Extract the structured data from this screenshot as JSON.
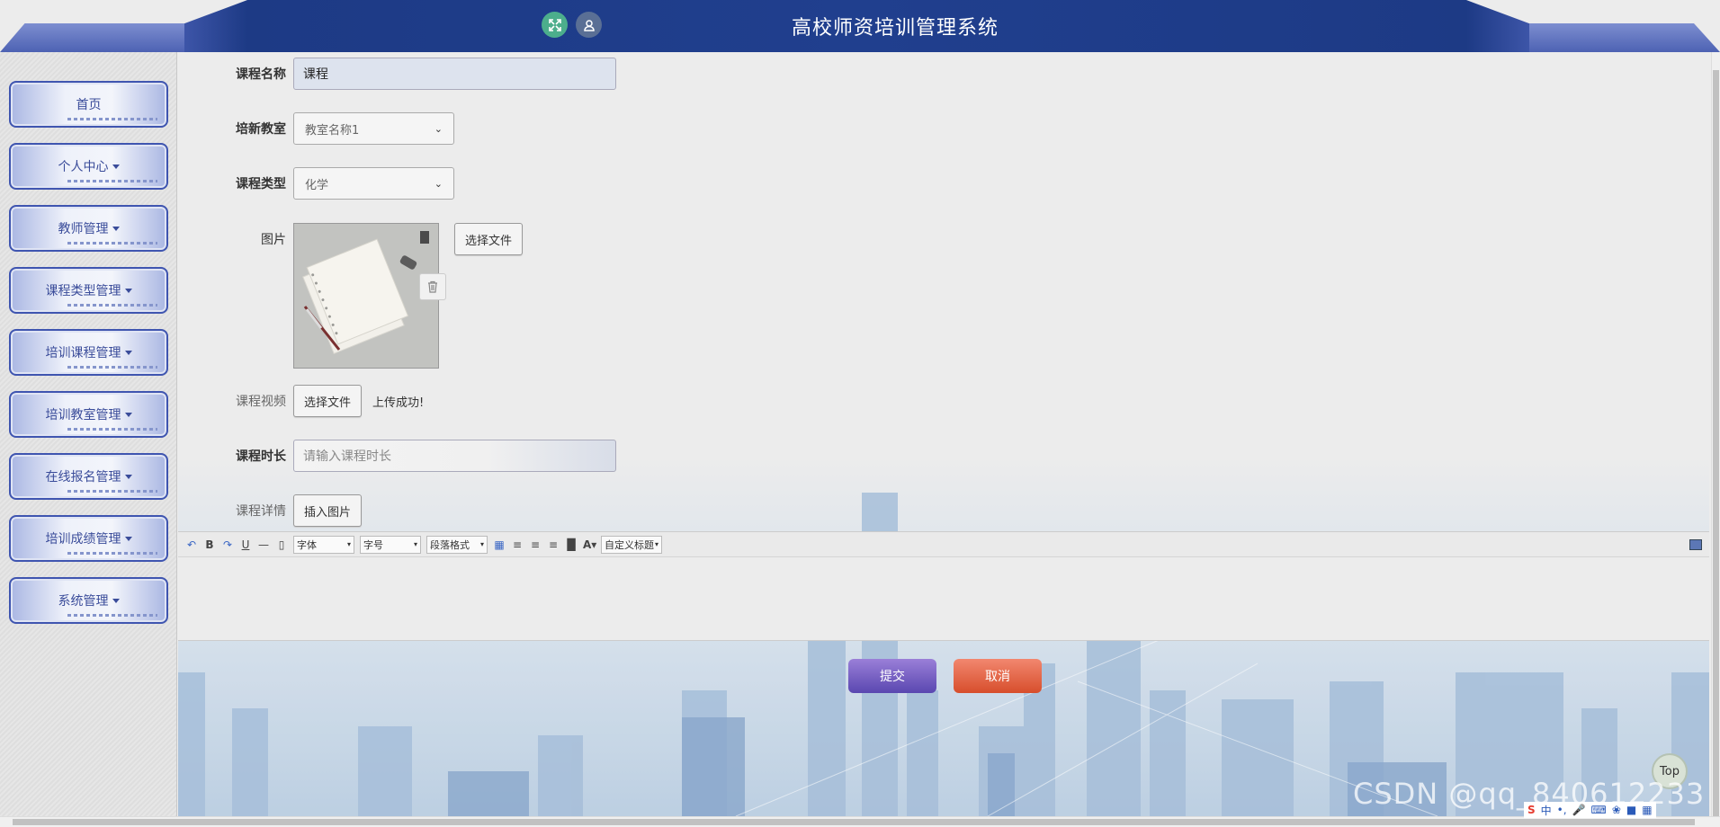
{
  "header": {
    "title": "高校师资培训管理系统"
  },
  "sidebar": {
    "items": [
      {
        "label": "首页",
        "has_dropdown": false
      },
      {
        "label": "个人中心",
        "has_dropdown": true
      },
      {
        "label": "教师管理",
        "has_dropdown": true
      },
      {
        "label": "课程类型管理",
        "has_dropdown": true
      },
      {
        "label": "培训课程管理",
        "has_dropdown": true
      },
      {
        "label": "培训教室管理",
        "has_dropdown": true
      },
      {
        "label": "在线报名管理",
        "has_dropdown": true
      },
      {
        "label": "培训成绩管理",
        "has_dropdown": true
      },
      {
        "label": "系统管理",
        "has_dropdown": true
      }
    ]
  },
  "form": {
    "course_name": {
      "label": "课程名称",
      "value": "课程"
    },
    "classroom": {
      "label": "培新教室",
      "selected": "教室名称1"
    },
    "course_type": {
      "label": "课程类型",
      "selected": "化学"
    },
    "image": {
      "label": "图片",
      "button": "选择文件"
    },
    "video": {
      "label": "课程视频",
      "button": "选择文件",
      "status": "上传成功!"
    },
    "duration": {
      "label": "课程时长",
      "placeholder": "请输入课程时长"
    },
    "details": {
      "label": "课程详情",
      "button": "插入图片"
    }
  },
  "editor": {
    "font_label": "字体",
    "size_label": "字号",
    "paragraph_label": "段落格式",
    "custom_title_label": "自定义标题"
  },
  "actions": {
    "submit": "提交",
    "cancel": "取消"
  },
  "top_button": "Top",
  "watermark": "CSDN @qq_840612233",
  "tray": {
    "ime": "中"
  },
  "colors": {
    "header_bg": "#1d3a85",
    "nav_border": "#3f55b0",
    "submit": "#5a47b0",
    "cancel": "#d74e2c"
  }
}
